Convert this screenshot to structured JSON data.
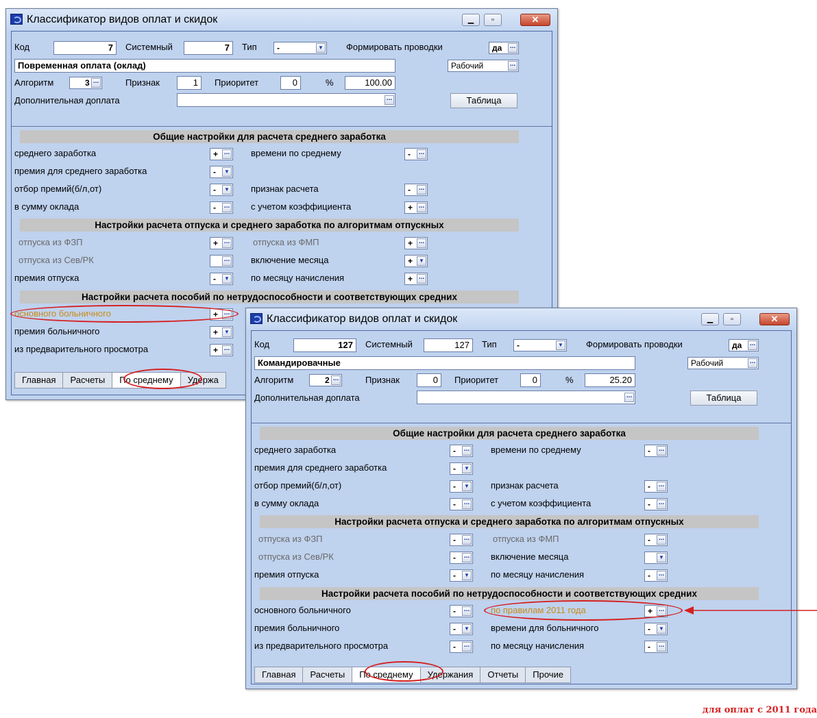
{
  "window1": {
    "title": "Классификатор видов оплат и скидок",
    "kod_label": "Код",
    "kod_value": "7",
    "sistemny_label": "Системный",
    "sistemny_value": "7",
    "tip_label": "Тип",
    "tip_value": "-",
    "formirovat_label": "Формировать проводки",
    "formirovat_value": "да",
    "name_value": "Повременная оплата (оклад)",
    "rabochiy_value": "Рабочий",
    "algoritm_label": "Алгоритм",
    "algoritm_value": "3",
    "priznak_label": "Признак",
    "priznak_value": "1",
    "prioritet_label": "Приоритет",
    "prioritet_value": "0",
    "percent_label": "%",
    "percent_value": "100.00",
    "dop_label": "Дополнительная доплата",
    "dop_value": "",
    "table_button": "Таблица",
    "section1": "Общие настройки для расчета среднего заработка",
    "section2": "Настройки расчета отпуска и среднего заработка по алгоритмам отпускных",
    "section3": "Настройки расчета пособий по нетрудоспособности и соответствующих средних",
    "rows": {
      "srednego_zarabotka": {
        "label": "среднего заработка",
        "value": "+"
      },
      "premiya_srednego": {
        "label": "премия для среднего заработка",
        "value": "-"
      },
      "otbor_premiy": {
        "label": "отбор премий(б/л,от)",
        "value": "-"
      },
      "v_summu_oklada": {
        "label": "в сумму оклада",
        "value": "-"
      },
      "vremeni_po_srednemu": {
        "label": "времени по среднему",
        "value": "-"
      },
      "priznak_rascheta": {
        "label": "признак расчета",
        "value": "-"
      },
      "s_uchetom": {
        "label": "с учетом коэффициента",
        "value": "+"
      },
      "otpuska_fzp": {
        "label": "отпуска из ФЗП",
        "value": "+"
      },
      "otpuska_sevrk": {
        "label": "отпуска из Сев/РК",
        "value": ""
      },
      "premiya_otpuska": {
        "label": "премия отпуска",
        "value": "-"
      },
      "otpuska_fmp": {
        "label": "отпуска из ФМП",
        "value": "+"
      },
      "vklyuchenie_mesyaca": {
        "label": "включение месяца",
        "value": "+"
      },
      "po_mesyacu": {
        "label": "по месяцу начисления",
        "value": "+"
      },
      "osnovnogo": {
        "label": "основного больничного",
        "value": "+"
      },
      "premiya_boln": {
        "label": "премия больничного",
        "value": "+"
      },
      "iz_predv": {
        "label": "из предварительного просмотра",
        "value": "+"
      }
    },
    "tabs": [
      "Главная",
      "Расчеты",
      "По среднему",
      "Удержа"
    ]
  },
  "window2": {
    "title": "Классификатор видов оплат и скидок",
    "kod_label": "Код",
    "kod_value": "127",
    "sistemny_label": "Системный",
    "sistemny_value": "127",
    "tip_label": "Тип",
    "tip_value": "-",
    "formirovat_label": "Формировать проводки",
    "formirovat_value": "да",
    "name_value": "Командировачные",
    "rabochiy_value": "Рабочий",
    "algoritm_label": "Алгоритм",
    "algoritm_value": "2",
    "priznak_label": "Признак",
    "priznak_value": "0",
    "prioritet_label": "Приоритет",
    "prioritet_value": "0",
    "percent_label": "%",
    "percent_value": "25.20",
    "dop_label": "Дополнительная доплата",
    "dop_value": "",
    "table_button": "Таблица",
    "section1": "Общие настройки для расчета среднего заработка",
    "section2": "Настройки расчета отпуска и среднего заработка по алгоритмам отпускных",
    "section3": "Настройки расчета пособий по нетрудоспособности и соответствующих средних",
    "rows": {
      "srednego_zarabotka": {
        "label": "среднего заработка",
        "value": "-"
      },
      "premiya_srednego": {
        "label": "премия для среднего заработка",
        "value": "-"
      },
      "otbor_premiy": {
        "label": "отбор премий(б/л,от)",
        "value": "-"
      },
      "v_summu_oklada": {
        "label": "в сумму оклада",
        "value": "-"
      },
      "vremeni_po_srednemu": {
        "label": "времени по среднему",
        "value": "-"
      },
      "priznak_rascheta": {
        "label": "признак расчета",
        "value": "-"
      },
      "s_uchetom": {
        "label": "с учетом коэффициента",
        "value": "-"
      },
      "otpuska_fzp": {
        "label": "отпуска из ФЗП",
        "value": "-"
      },
      "otpuska_sevrk": {
        "label": "отпуска из Сев/РК",
        "value": "-"
      },
      "premiya_otpuska": {
        "label": "премия отпуска",
        "value": "-"
      },
      "otpuska_fmp": {
        "label": "отпуска из ФМП",
        "value": "-"
      },
      "vklyuchenie_mesyaca": {
        "label": "включение месяца",
        "value": ""
      },
      "po_mesyacu": {
        "label": "по месяцу начисления",
        "value": "-"
      },
      "osnovnogo": {
        "label": "основного больничного",
        "value": "-"
      },
      "premiya_boln": {
        "label": "премия больничного",
        "value": "-"
      },
      "iz_predv": {
        "label": "из предварительного просмотра",
        "value": "-"
      },
      "po_pravilam": {
        "label": "по правилам 2011 года",
        "value": "+"
      },
      "vremeni_boln": {
        "label": "времени для больничного",
        "value": "-"
      },
      "po_mesyacu_boln": {
        "label": "по месяцу начисления",
        "value": "-"
      }
    },
    "tabs": [
      "Главная",
      "Расчеты",
      "По среднему",
      "Удержания",
      "Отчеты",
      "Прочие"
    ]
  },
  "annotation": {
    "note": "для оплат с 2011 года",
    "highlight_color": "#d62020"
  }
}
